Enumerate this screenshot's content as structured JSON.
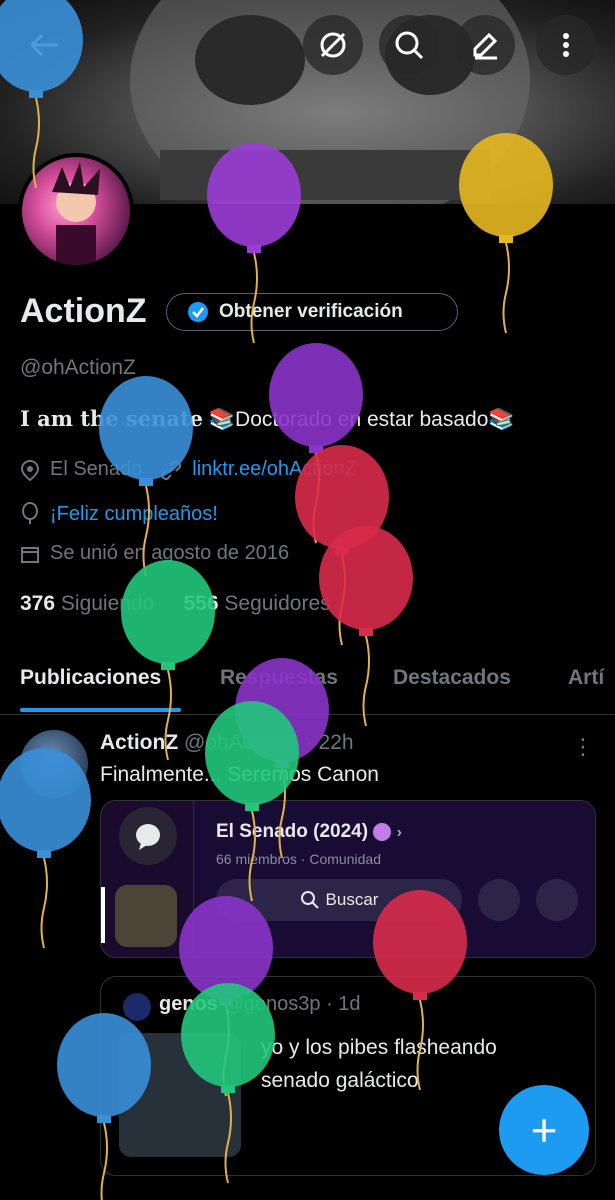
{
  "profile": {
    "name": "ActionZ",
    "verify_label": "Obtener verificación",
    "handle": "@ohActionZ",
    "bio_serif": "I am the senate",
    "bio_rest": "📚Doctorado en estar basado📚",
    "location": "El Senado",
    "link": "linktr.ee/ohActionZ",
    "birthday": "¡Feliz cumpleaños!",
    "joined": "Se unió en agosto de 2016",
    "following_count": "376",
    "following_label": "Siguiendo",
    "followers_count": "556",
    "followers_label": "Seguidores"
  },
  "tabs": [
    {
      "label": "Publicaciones"
    },
    {
      "label": "Respuestas"
    },
    {
      "label": "Destacados"
    },
    {
      "label": "Artí"
    }
  ],
  "post": {
    "author": "ActionZ",
    "handle": "@ohActionZ",
    "time": "22h",
    "text": "Finalmente... Seremos Canon",
    "media": {
      "community_name": "El Senado (2024)",
      "members": "66 miembros",
      "type": "Comunidad",
      "search_label": "Buscar"
    },
    "quote": {
      "author": "genos",
      "handle": "@genos3p",
      "time": "1d",
      "text_line1": "yo y los pibes flasheando",
      "text_line2": "senado galáctico"
    }
  },
  "icons": {
    "back": "arrow-left-icon",
    "hide": "eye-slash-icon",
    "search": "search-icon",
    "edit": "pencil-icon",
    "more": "more-vertical-icon",
    "verified": "verified-badge-icon",
    "location": "location-pin-icon",
    "link": "link-icon",
    "birthday": "balloon-icon",
    "calendar": "calendar-icon",
    "compose": "plus-icon"
  },
  "colors": {
    "accent": "#1d9bf0",
    "background": "#000000",
    "muted_text": "#71767b"
  }
}
